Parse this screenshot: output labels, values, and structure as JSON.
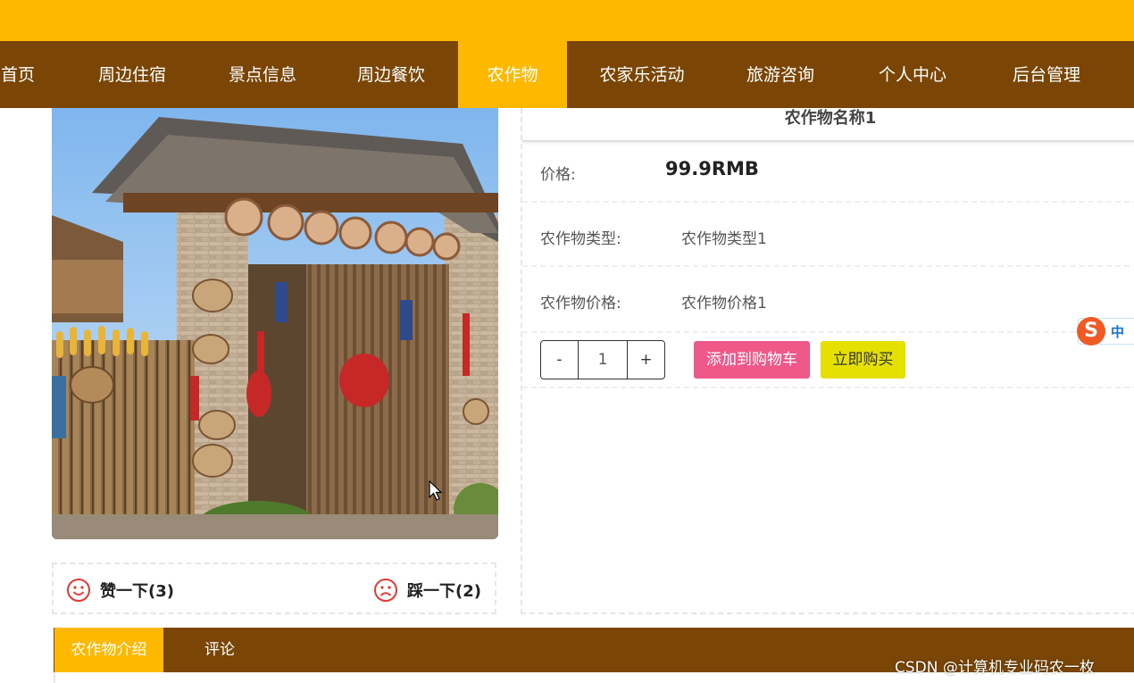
{
  "nav": {
    "items": [
      {
        "label": "首页"
      },
      {
        "label": "周边住宿"
      },
      {
        "label": "景点信息"
      },
      {
        "label": "周边餐饮"
      },
      {
        "label": "农作物"
      },
      {
        "label": "农家乐活动"
      },
      {
        "label": "旅游咨询"
      },
      {
        "label": "个人中心"
      },
      {
        "label": "后台管理"
      }
    ],
    "active": "农作物"
  },
  "product": {
    "title": "农作物名称1",
    "price_label": "价格:",
    "price_value": "99.9RMB",
    "type_label": "农作物类型:",
    "type_value": "农作物类型1",
    "crop_price_label": "农作物价格:",
    "crop_price_value": "农作物价格1",
    "quantity": "1",
    "minus": "-",
    "plus": "+",
    "add_to_cart": "添加到购物车",
    "buy_now": "立即购买"
  },
  "votes": {
    "like_label": "赞一下(3)",
    "dislike_label": "踩一下(2)"
  },
  "tabs": [
    {
      "label": "农作物介绍"
    },
    {
      "label": "评论"
    }
  ],
  "ime": {
    "lang": "中"
  },
  "watermark": "CSDN @计算机专业码农一枚",
  "colors": {
    "topbar": "#ffb800",
    "nav_bg": "#7a4505",
    "active": "#ffb800",
    "cart_button": "#f1588a",
    "buy_button": "#e6e000",
    "vote_icon": "#e53935"
  }
}
